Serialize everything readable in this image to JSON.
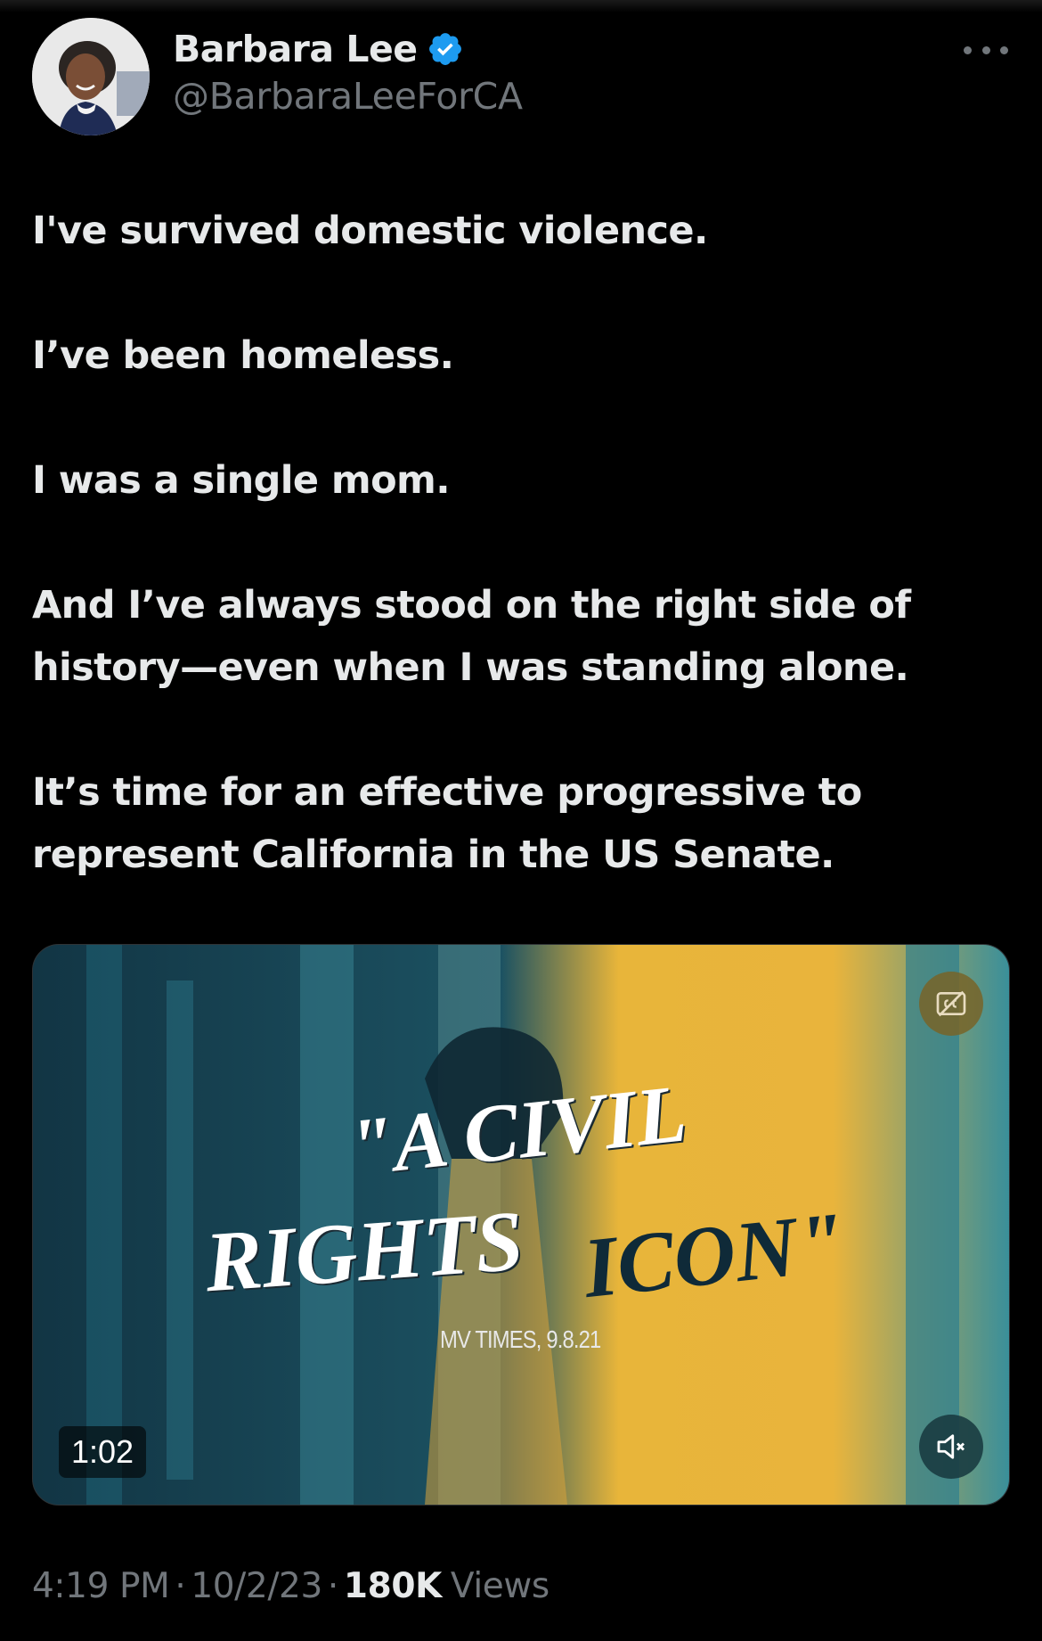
{
  "author": {
    "display_name": "Barbara Lee",
    "handle": "@BarbaraLeeForCA",
    "verified": true,
    "verified_color": "#1d9bf0",
    "avatar_icon": "profile-photo"
  },
  "more_icon": "more-horizontal-icon",
  "tweet": {
    "paragraphs": [
      "I've survived domestic violence.",
      "I’ve been homeless.",
      "I was a single mom.",
      "And I’ve always stood on the right side of",
      "history—even when I was standing alone.",
      "It’s time for an effective progressive to",
      "represent California in the US Senate."
    ]
  },
  "video": {
    "caption_line1": "\"A CIVIL",
    "caption_line2a": "RIGHTS",
    "caption_line2b": "ICON\"",
    "source": "MV TIMES, 9.8.21",
    "duration": "1:02",
    "cc_icon": "closed-captions-off-icon",
    "mute_icon": "volume-muted-icon",
    "colors": {
      "teal": "#143a4a",
      "yellow": "#e8b53a"
    }
  },
  "meta": {
    "time": "4:19 PM",
    "separator": "·",
    "date": "10/2/23",
    "views_count": "180K",
    "views_label": "Views"
  }
}
